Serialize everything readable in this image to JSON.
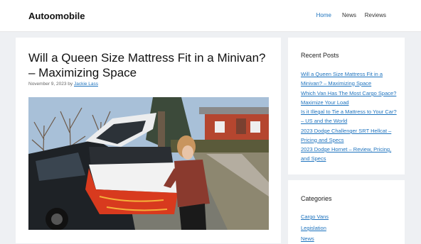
{
  "site": {
    "title": "Autoomobile"
  },
  "nav": {
    "items": [
      {
        "label": "Home",
        "active": true
      },
      {
        "label": "News",
        "active": false
      },
      {
        "label": "Reviews",
        "active": false
      }
    ]
  },
  "post": {
    "title": "Will a Queen Size Mattress Fit in a Minivan? – Maximizing Space",
    "date": "November 9, 2023",
    "by": "by",
    "author": "Jackie Lass"
  },
  "sidebar": {
    "recent_posts": {
      "title": "Recent Posts",
      "items": [
        "Will a Queen Size Mattress Fit in a Minivan? – Maximizing Space",
        "Which Van Has The Most Cargo Space? Maximize Your Load",
        "Is it Illegal to Tie a Mattress to Your Car? – US and the World",
        "2023 Dodge Challenger SRT Hellcat – Pricing and Specs",
        "2023 Dodge Hornet – Review, Pricing, and Specs"
      ]
    },
    "categories": {
      "title": "Categories",
      "items": [
        "Cargo Vans",
        "Legislation",
        "News"
      ]
    }
  },
  "colors": {
    "link": "#1e73be",
    "background": "#eef0f3"
  }
}
